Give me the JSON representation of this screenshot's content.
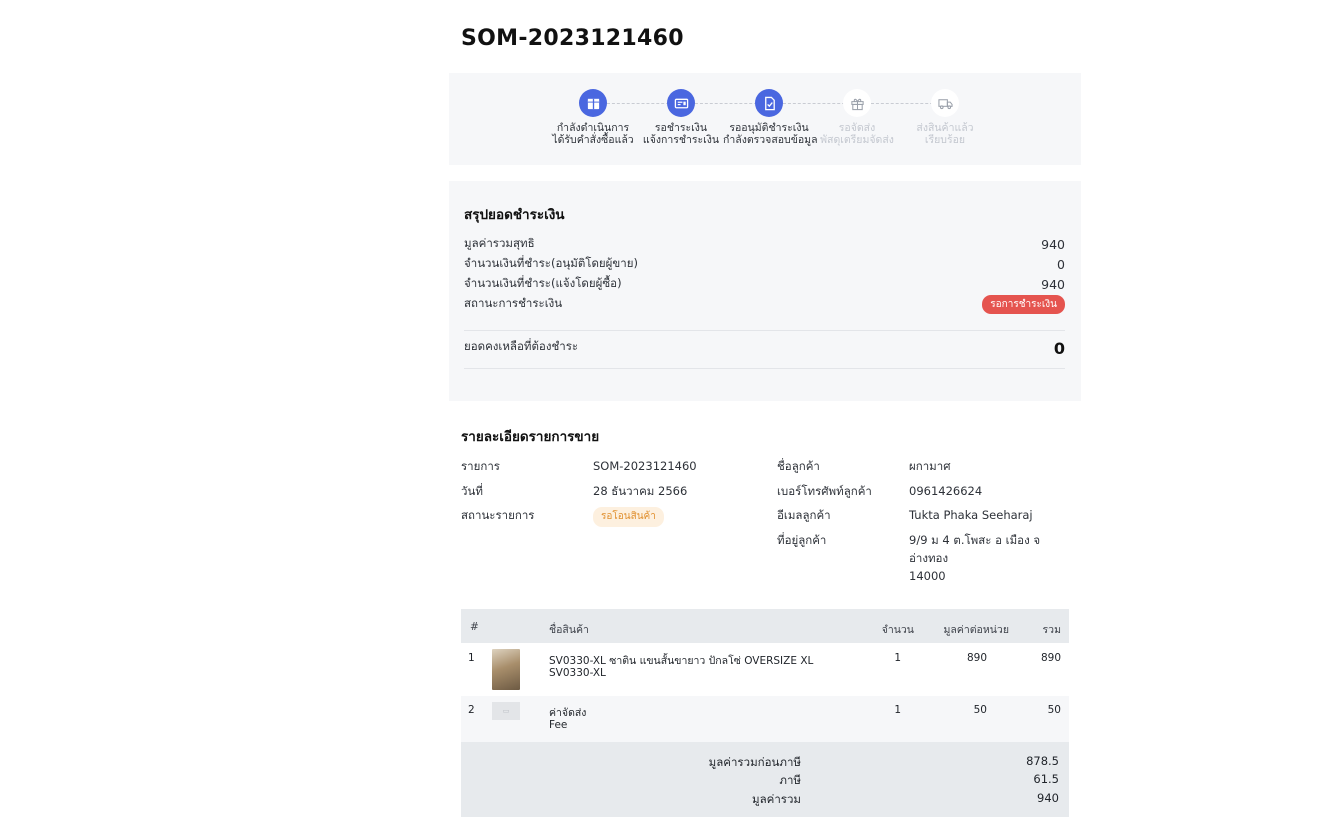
{
  "order_code": "SOM-2023121460",
  "stepper": {
    "steps": [
      {
        "title": "กำลังดำเนินการ",
        "sub": "ได้รับคำสั่งซื้อแล้ว",
        "icon": "box-icon",
        "state": "active"
      },
      {
        "title": "รอชำระเงิน",
        "sub": "แจ้งการชำระเงิน",
        "icon": "payment-card-icon",
        "state": "active"
      },
      {
        "title": "รออนุมัติชำระเงิน",
        "sub": "กำลังตรวจสอบข้อมูล",
        "icon": "document-check-icon",
        "state": "active"
      },
      {
        "title": "รอจัดส่ง",
        "sub": "พัสดุเตรียมจัดส่ง",
        "icon": "gift-box-icon",
        "state": "inactive"
      },
      {
        "title": "ส่งสินค้าแล้ว",
        "sub": "เรียบร้อย",
        "icon": "truck-icon",
        "state": "inactive"
      }
    ]
  },
  "payment": {
    "title": "สรุปยอดชำระเงิน",
    "net_label": "มูลค่ารวมสุทธิ",
    "net_value": "940",
    "paid_approved_label": "จำนวนเงินที่ชำระ(อนุมัติโดยผู้ขาย)",
    "paid_approved_value": "0",
    "paid_reported_label": "จำนวนเงินที่ชำระ(แจ้งโดยผู้ซื้อ)",
    "paid_reported_value": "940",
    "status_label": "สถานะการชำระเงิน",
    "status_value": "รอการชำระเงิน",
    "balance_label": "ยอดคงเหลือที่ต้องชำระ",
    "balance_value": "0"
  },
  "detail": {
    "title": "รายละเอียดรายการขาย",
    "item_label": "รายการ",
    "item_value": "SOM-2023121460",
    "date_label": "วันที่",
    "date_value": "28 ธันวาคม 2566",
    "status_label": "สถานะรายการ",
    "status_value": "รอโอนสินค้า",
    "customer_name_label": "ชื่อลูกค้า",
    "customer_name_value": "ผกามาศ",
    "phone_label": "เบอร์โทรศัพท์ลูกค้า",
    "phone_value": "0961426624",
    "email_label": "อีเมลลูกค้า",
    "email_value": "Tukta Phaka Seeharaj",
    "address_label": "ที่อยู่ลูกค้า",
    "address_line1": "9/9 ม 4 ต.โพสะ อ เมือง จ",
    "address_line2": "อ่างทอง",
    "address_line3": "14000"
  },
  "table": {
    "headers": {
      "no": "#",
      "product": "ชื่อสินค้า",
      "qty": "จำนวน",
      "unit_price": "มูลค่าต่อหน่วย",
      "total": "รวม"
    },
    "rows": [
      {
        "no": "1",
        "name": "SV0330-XL ซาติน แขนสั้นขายาว ปักลโซ่ OVERSIZE XL",
        "sku": "SV0330-XL",
        "qty": "1",
        "unit_price": "890",
        "total": "890"
      },
      {
        "no": "2",
        "name": "ค่าจัดส่ง",
        "sku": "Fee",
        "qty": "1",
        "unit_price": "50",
        "total": "50"
      }
    ],
    "totals": {
      "pre_tax_label": "มูลค่ารวมก่อนภาษี",
      "pre_tax_value": "878.5",
      "tax_label": "ภาษี",
      "tax_value": "61.5",
      "grand_label": "มูลค่ารวม",
      "grand_value": "940"
    }
  },
  "colors": {
    "accent": "#4a67e0",
    "panel_bg": "#f6f7f9",
    "badge_red": "#e5544f",
    "badge_orange_text": "#e08f2e",
    "table_head_bg": "#e7eaed"
  }
}
